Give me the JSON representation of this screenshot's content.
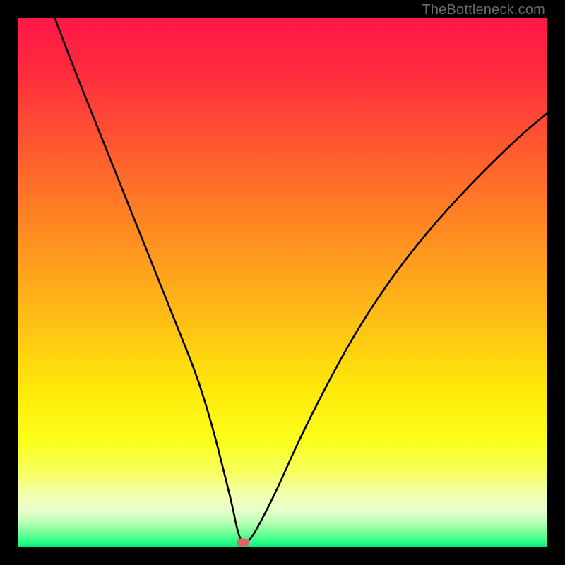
{
  "watermark": "TheBottleneck.com",
  "marker": {
    "x_pct": 42.5,
    "y_pct": 99.0,
    "color": "#e06666"
  },
  "gradient_stops": [
    {
      "pct": 0,
      "color": "#ff1746"
    },
    {
      "pct": 10,
      "color": "#ff2b3e"
    },
    {
      "pct": 25,
      "color": "#ff5a2f"
    },
    {
      "pct": 40,
      "color": "#ff8a22"
    },
    {
      "pct": 55,
      "color": "#ffb817"
    },
    {
      "pct": 70,
      "color": "#ffe80a"
    },
    {
      "pct": 80,
      "color": "#fbff1a"
    },
    {
      "pct": 86,
      "color": "#f6ff62"
    },
    {
      "pct": 90,
      "color": "#f4ffad"
    },
    {
      "pct": 93,
      "color": "#e6ffca"
    },
    {
      "pct": 95,
      "color": "#c1ffb8"
    },
    {
      "pct": 97,
      "color": "#7dff9c"
    },
    {
      "pct": 99,
      "color": "#2aff88"
    },
    {
      "pct": 100,
      "color": "#00e67a"
    }
  ],
  "chart_data": {
    "type": "line",
    "title": "",
    "xlabel": "",
    "ylabel": "",
    "xlim": [
      0,
      100
    ],
    "ylim": [
      0,
      100
    ],
    "note": "x is percent across plot width, y is bottleneck percent (0 at bottom/green, 100 at top/red). V-shaped curve with minimum near x≈42.",
    "series": [
      {
        "name": "bottleneck-curve",
        "x": [
          7,
          10,
          14,
          18,
          22,
          26,
          30,
          34,
          37,
          39,
          40.5,
          41.5,
          42.5,
          44,
          46,
          49,
          53,
          58,
          64,
          72,
          82,
          94,
          100
        ],
        "y": [
          100,
          92,
          82,
          72,
          62,
          52,
          42,
          32,
          22,
          14,
          8,
          3,
          0.5,
          1.5,
          5,
          11,
          20,
          30,
          41,
          53,
          65,
          77,
          82
        ]
      }
    ],
    "marker": {
      "x": 42.5,
      "y": 1.0
    },
    "background": "vertical-gradient-red-to-green"
  }
}
